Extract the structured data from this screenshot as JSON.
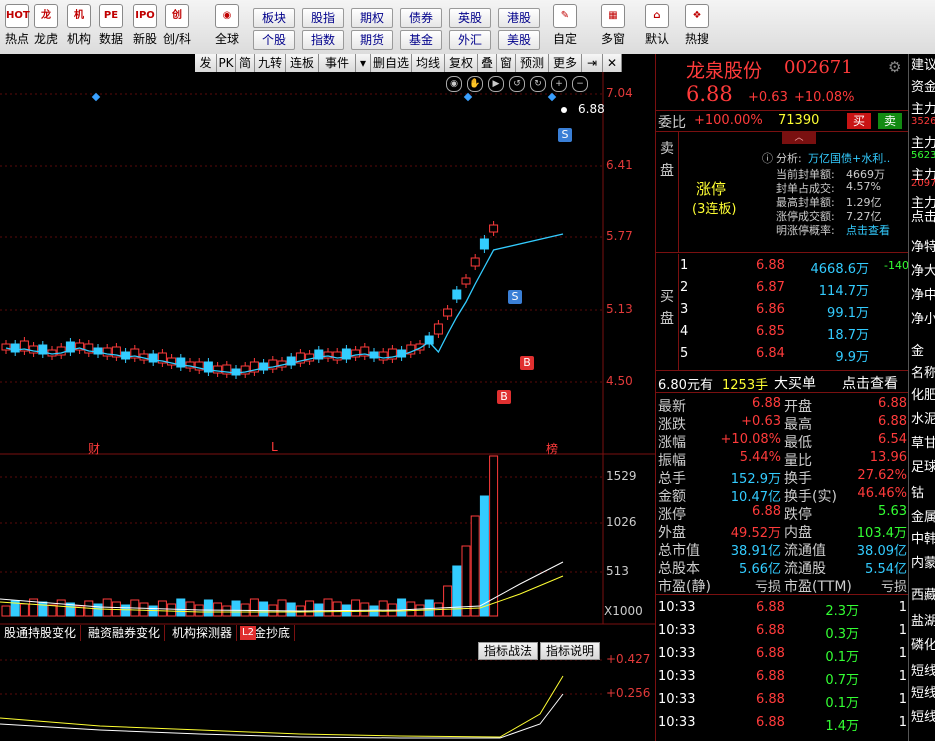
{
  "toolbar": {
    "left_items": [
      {
        "label": "热点",
        "icon": "hot-icon",
        "glyph": "HOT"
      },
      {
        "label": "龙虎",
        "icon": "dragon-icon",
        "glyph": "龙"
      },
      {
        "label": "机构",
        "icon": "building-icon",
        "glyph": "机"
      },
      {
        "label": "数据",
        "icon": "pe-icon",
        "glyph": "PE"
      },
      {
        "label": "新股",
        "icon": "ipo-icon",
        "glyph": "IPO"
      },
      {
        "label": "创/科",
        "icon": "chuang-icon",
        "glyph": "创"
      },
      {
        "label": "全球",
        "icon": "globe-icon",
        "glyph": "◉"
      }
    ],
    "market_top": [
      "板块",
      "股指",
      "期权",
      "债券",
      "英股",
      "港股"
    ],
    "market_bottom": [
      "个股",
      "指数",
      "期货",
      "基金",
      "外汇",
      "美股"
    ],
    "right_items": [
      {
        "label": "自定",
        "icon": "custom-icon",
        "glyph": "✎"
      },
      {
        "label": "多窗",
        "icon": "multiwindow-icon",
        "glyph": "▦"
      },
      {
        "label": "默认",
        "icon": "home-icon",
        "glyph": "⌂"
      },
      {
        "label": "热搜",
        "icon": "hotsearch-icon",
        "glyph": "❖"
      }
    ]
  },
  "chart_toolbar": [
    "发",
    "PK",
    "简",
    "九转",
    "连板",
    "事件",
    "▾",
    "删自选",
    "均线",
    "复权",
    "叠",
    "窗",
    "预测",
    "更多",
    "⇥",
    "✕"
  ],
  "price_axis": [
    "7.04",
    "6.41",
    "5.77",
    "5.13",
    "4.50"
  ],
  "last_price_tag": "6.88",
  "event_markers": {
    "cai": "财",
    "l": "L",
    "bang": "榜"
  },
  "signals": {
    "buy": "B",
    "sell": "S"
  },
  "volume_axis": [
    "1529",
    "1026",
    "513",
    "X1000"
  ],
  "indicator_tabs": [
    "股通持股变化",
    "融资融券变化",
    "机构探测器",
    "资金抄底"
  ],
  "l2_badge": "L2",
  "indicator_buttons": [
    "指标战法",
    "指标说明"
  ],
  "indicator_axis": [
    "+0.427",
    "+0.256"
  ],
  "stock": {
    "name": "龙泉股份",
    "code": "002671",
    "price": "6.88",
    "change": "+0.63",
    "pct": "+10.08%"
  },
  "weibi": {
    "label": "委比",
    "value": "+100.00%",
    "volume": "71390",
    "buy": "买",
    "sell": "卖"
  },
  "sell_label": "卖盘",
  "limit": {
    "title": "涨停",
    "streak": "(3连板)",
    "analysis_label": "分析:",
    "analysis_value": "万亿国债+水利..",
    "rows": [
      {
        "k": "当前封单额:",
        "v": "4669万"
      },
      {
        "k": "封单占成交:",
        "v": "4.57%"
      },
      {
        "k": "最高封单额:",
        "v": "1.29亿"
      },
      {
        "k": "涨停成交额:",
        "v": "7.27亿"
      },
      {
        "k": "明涨停概率:",
        "v": "点击查看"
      }
    ]
  },
  "buy_label": "买盘",
  "bids": [
    {
      "n": "1",
      "p": "6.88",
      "v": "4668.6万",
      "d": "-140"
    },
    {
      "n": "2",
      "p": "6.87",
      "v": "114.7万",
      "d": ""
    },
    {
      "n": "3",
      "p": "6.86",
      "v": "99.1万",
      "d": ""
    },
    {
      "n": "4",
      "p": "6.85",
      "v": "18.7万",
      "d": ""
    },
    {
      "n": "5",
      "p": "6.84",
      "v": "9.9万",
      "d": ""
    }
  ],
  "big_order": {
    "price": "6.80元有",
    "qty": "1253手",
    "label": "大买单",
    "link": "点击查看"
  },
  "stats": [
    [
      "最新",
      "6.88",
      "开盘",
      "6.88"
    ],
    [
      "涨跌",
      "+0.63",
      "最高",
      "6.88"
    ],
    [
      "涨幅",
      "+10.08%",
      "最低",
      "6.54"
    ],
    [
      "振幅",
      "5.44%",
      "量比",
      "13.96"
    ],
    [
      "总手",
      "152.9万",
      "换手",
      "27.62%"
    ],
    [
      "金额",
      "10.47亿",
      "换手(实)",
      "46.46%"
    ],
    [
      "涨停",
      "6.88",
      "跌停",
      "5.63"
    ],
    [
      "外盘",
      "49.52万",
      "内盘",
      "103.4万"
    ],
    [
      "总市值",
      "38.91亿",
      "流通值",
      "38.09亿"
    ],
    [
      "总股本",
      "5.66亿",
      "流通股",
      "5.54亿"
    ],
    [
      "市盈(静)",
      "亏损",
      "市盈(TTM)",
      "亏损"
    ]
  ],
  "ticks": [
    {
      "t": "10:33",
      "p": "6.88",
      "v": "2.3万"
    },
    {
      "t": "10:33",
      "p": "6.88",
      "v": "0.3万"
    },
    {
      "t": "10:33",
      "p": "6.88",
      "v": "0.1万"
    },
    {
      "t": "10:33",
      "p": "6.88",
      "v": "0.7万"
    },
    {
      "t": "10:33",
      "p": "6.88",
      "v": "0.1万"
    },
    {
      "t": "10:33",
      "p": "6.88",
      "v": "1.4万"
    }
  ],
  "tick_side": "1",
  "strip": [
    "建议",
    "资金",
    "主力",
    "3526",
    "主力",
    "5623",
    "主力",
    "2097",
    "主力",
    "点击",
    "净特",
    "净大",
    "净中",
    "净小",
    "金",
    "名称",
    "化肥",
    "水泥",
    "草甘",
    "足球",
    "钴",
    "金属",
    "中韩",
    "内蒙",
    "西藏",
    "盐湖",
    "磷化",
    "短线",
    "短线",
    "短线"
  ],
  "colors": {
    "up": "#ff3b3b",
    "down": "#33ccff",
    "limit_bg": "#000000"
  }
}
